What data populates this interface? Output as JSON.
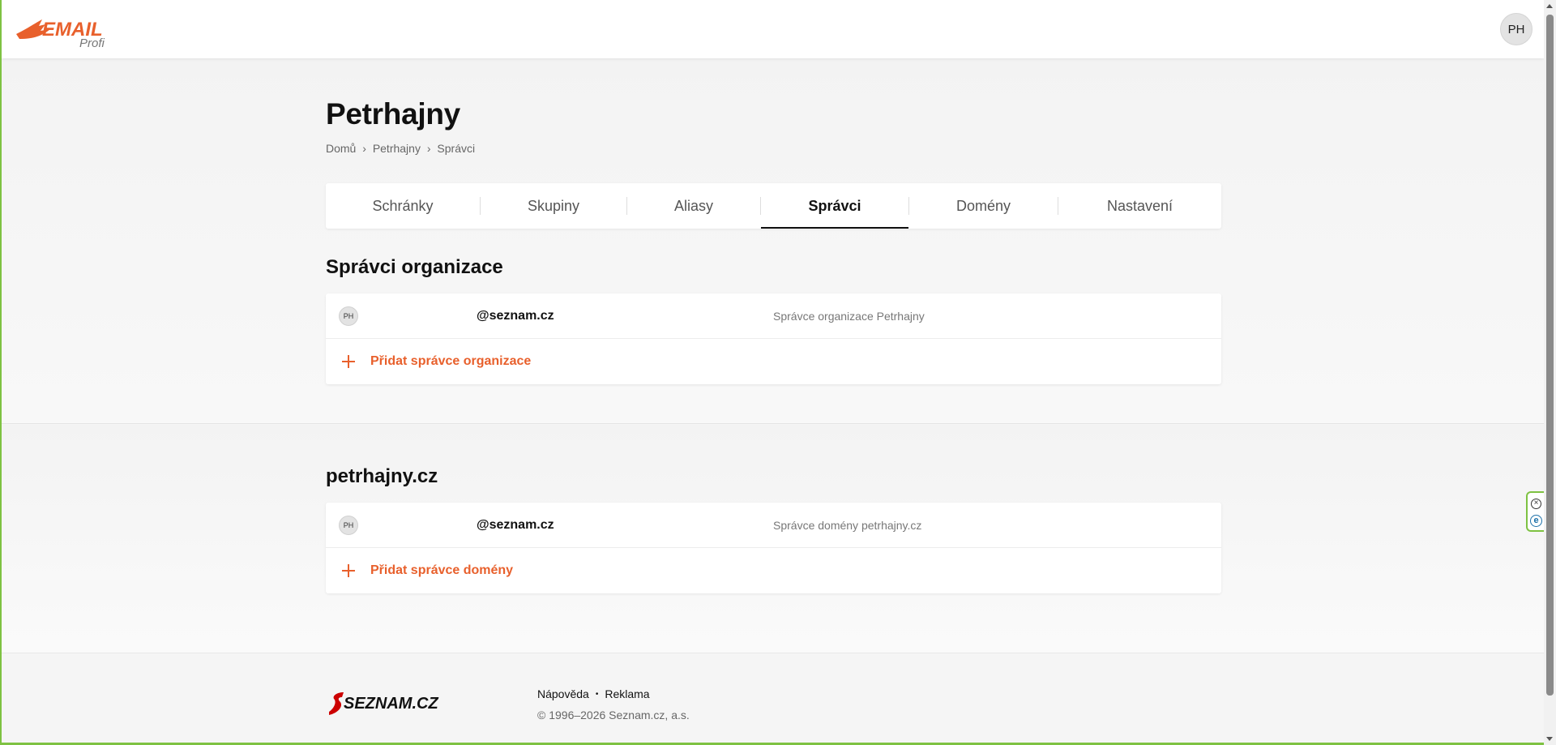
{
  "header": {
    "logo_word": "EMAIL",
    "logo_sub": "Profi",
    "avatar_initials": "PH"
  },
  "page": {
    "title": "Petrhajny",
    "breadcrumb": [
      "Domů",
      "Petrhajny",
      "Správci"
    ],
    "breadcrumb_sep": "›"
  },
  "tabs": [
    {
      "label": "Schránky",
      "active": false
    },
    {
      "label": "Skupiny",
      "active": false
    },
    {
      "label": "Aliasy",
      "active": false
    },
    {
      "label": "Správci",
      "active": true
    },
    {
      "label": "Domény",
      "active": false
    },
    {
      "label": "Nastavení",
      "active": false
    }
  ],
  "org_admins": {
    "heading": "Správci organizace",
    "rows": [
      {
        "initials": "PH",
        "email": "@seznam.cz",
        "role": "Správce organizace Petrhajny"
      }
    ],
    "add_label": "Přidat správce organizace"
  },
  "domain_admins": {
    "heading": "petrhajny.cz",
    "rows": [
      {
        "initials": "PH",
        "email": "@seznam.cz",
        "role": "Správce domény petrhajny.cz"
      }
    ],
    "add_label": "Přidat správce domény"
  },
  "footer": {
    "logo_text": "SEZNAM.CZ",
    "links": [
      "Nápověda",
      "Reklama"
    ],
    "link_sep": "•",
    "copyright": "© 1996–2026 Seznam.cz, a.s."
  },
  "side_widget": {
    "close_glyph": "×",
    "e_glyph": "e"
  },
  "colors": {
    "accent": "#e8602c",
    "frame_border": "#7ec242",
    "seznam_red": "#cc0000"
  }
}
